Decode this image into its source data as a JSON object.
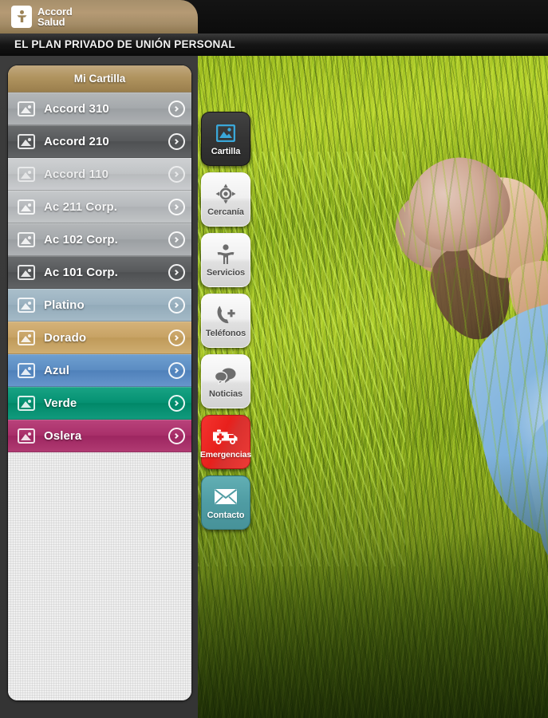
{
  "header": {
    "logo_line1": "Accord",
    "logo_line2": "Salud",
    "logo_icon": "person-tree-icon",
    "tagline": "EL PLAN PRIVADO DE UNIÓN PERSONAL"
  },
  "sidebar": {
    "panel_title": "Mi Cartilla",
    "row_icon": "picture-placeholder-icon",
    "row_chevron": "chevron-right-circle-icon",
    "items": [
      {
        "label": "Accord 310",
        "color": "#a4a8ab",
        "style": "c-lightgrey"
      },
      {
        "label": "Accord 210",
        "color": "#57595b",
        "style": "c-darkgrey"
      },
      {
        "label": "Accord 110",
        "color": "#c0c3c5",
        "style": "c-palegrey"
      },
      {
        "label": "Ac 211 Corp.",
        "color": "#b6b9bc",
        "style": "c-midgrey"
      },
      {
        "label": "Ac 102 Corp.",
        "color": "#a4a8ab",
        "style": "c-lightgrey"
      },
      {
        "label": "Ac 101 Corp.",
        "color": "#57595b",
        "style": "c-darkgrey"
      },
      {
        "label": "Platino",
        "color": "#9ab1c0",
        "style": "c-platino"
      },
      {
        "label": "Dorado",
        "color": "#c7a264",
        "style": "c-dorado"
      },
      {
        "label": "Azul",
        "color": "#5b8cc2",
        "style": "c-azul"
      },
      {
        "label": "Verde",
        "color": "#059172",
        "style": "c-verde"
      },
      {
        "label": "Oslera",
        "color": "#a82f69",
        "style": "c-oslera"
      }
    ]
  },
  "tabs": [
    {
      "label": "Cartilla",
      "icon": "picture-icon",
      "state": "active",
      "accent": "#3aa7d8"
    },
    {
      "label": "Cercanía",
      "icon": "compass-icon",
      "state": "light",
      "accent": "#6d6d6d"
    },
    {
      "label": "Servicios",
      "icon": "person-icon",
      "state": "light",
      "accent": "#6d6d6d"
    },
    {
      "label": "Teléfonos",
      "icon": "phone-plus-icon",
      "state": "light",
      "accent": "#6d6d6d"
    },
    {
      "label": "Noticias",
      "icon": "chat-bubbles-icon",
      "state": "light",
      "accent": "#6d6d6d"
    },
    {
      "label": "Emergencias",
      "icon": "ambulance-icon",
      "state": "emergencia",
      "accent": "#e8201c"
    },
    {
      "label": "Contacto",
      "icon": "envelope-icon",
      "state": "contacto",
      "accent": "#4f9ca3"
    }
  ],
  "background": {
    "description": "girl-lying-in-grass-photo"
  }
}
